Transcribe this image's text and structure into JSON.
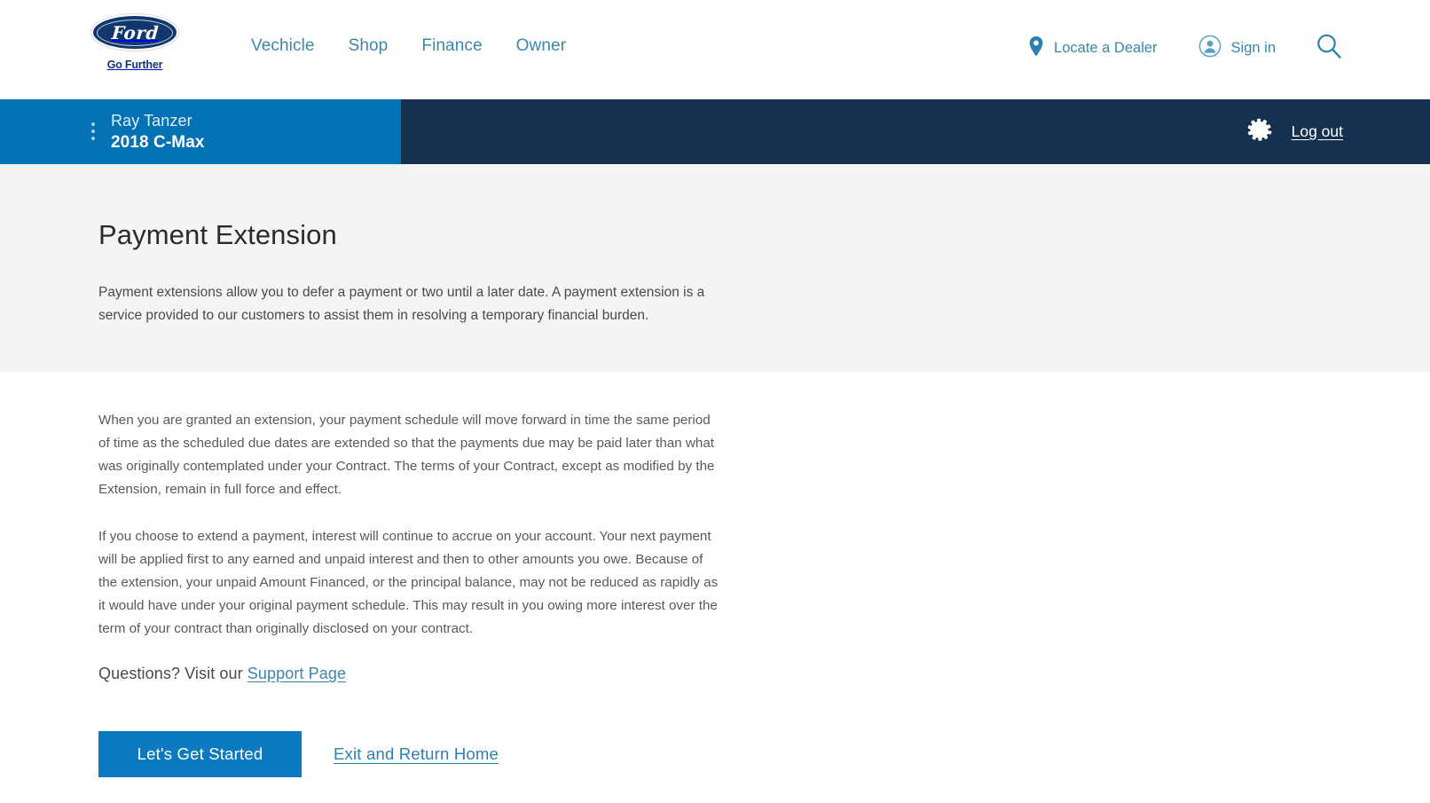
{
  "brand": {
    "logo_word": "Ford",
    "tagline": "Go Further",
    "logo_name": "ford-oval-logo"
  },
  "header": {
    "nav": [
      {
        "label": "Vechicle"
      },
      {
        "label": "Shop"
      },
      {
        "label": "Finance"
      },
      {
        "label": "Owner"
      }
    ],
    "locate_dealer": "Locate a Dealer",
    "sign_in": "Sign in",
    "icons": {
      "pin": "map-pin-icon",
      "user": "user-circle-icon",
      "search": "search-icon"
    }
  },
  "vehicle_bar": {
    "owner_name": "Ray Tanzer",
    "vehicle": "2018 C-Max",
    "log_out": "Log out",
    "gear_icon": "gear-icon",
    "menu_icon": "kebab-menu-icon"
  },
  "page": {
    "title": "Payment Extension",
    "intro": "Payment extensions allow you to defer a payment or two until a later date. A payment extension is a service provided to our customers to assist them in resolving a temporary financial burden.",
    "paragraph_1": "When you are granted an extension, your payment schedule will move forward in time the same period of time as the scheduled due dates are extended so that the payments due may be paid later than what was originally contemplated under your Contract.   The terms of your Contract, except as modified by the Extension, remain in full force and effect.",
    "paragraph_2": "If you choose to extend a payment, interest will continue to accrue on your account. Your next payment will be applied first to any earned and unpaid interest and then to other amounts you owe. Because of the extension, your unpaid Amount Financed, or the principal balance, may not be reduced as rapidly as it would have under your original payment schedule. This may result in you owing more interest over the term of your contract than originally disclosed on your contract.",
    "questions_text": "Questions? Visit our",
    "support_link": "Support Page"
  },
  "actions": {
    "primary": "Let's Get Started",
    "secondary": "Exit and Return Home"
  },
  "colors": {
    "brand_blue": "#0272b5",
    "dark_navy": "#16304f",
    "button_blue": "#0c7ac0",
    "link_blue": "#3a87ad",
    "logo_navy": "#11386e",
    "band_gray": "#f4f4f4"
  }
}
